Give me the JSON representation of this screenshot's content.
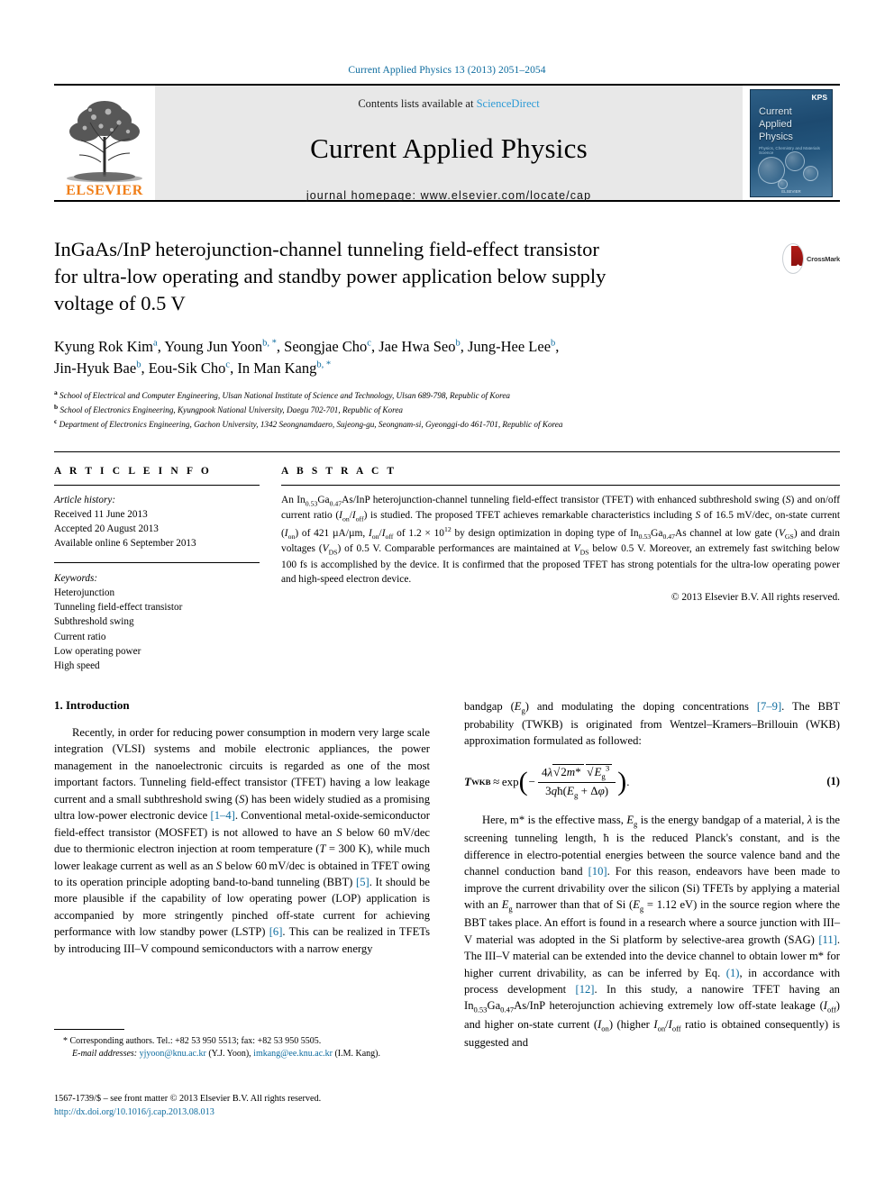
{
  "running_head": "Current Applied Physics 13 (2013) 2051–2054",
  "masthead": {
    "contents_prefix": "Contents lists available at ",
    "contents_link": "ScienceDirect",
    "journal_title": "Current Applied Physics",
    "homepage": "journal homepage: www.elsevier.com/locate/cap",
    "publisher_wordmark": "ELSEVIER",
    "cover": {
      "society": "KPS",
      "title_line1": "Current",
      "title_line2": "Applied",
      "title_line3": "Physics",
      "subtitle": "Physics, Chemistry and Materials Science",
      "footer": "ELSEVIER"
    }
  },
  "title": {
    "line1": "InGaAs/InP heterojunction-channel tunneling field-effect transistor",
    "line2": "for ultra-low operating and standby power application below supply",
    "line3": "voltage of 0.5 V",
    "crossmark_label": "CrossMark"
  },
  "authors": {
    "line1": "Kyung Rok Kim a, Young Jun Yoon b, *, Seongjae Cho c, Jae Hwa Seo b, Jung-Hee Lee b,",
    "line2": "Jin-Hyuk Bae b, Eou-Sik Cho c, In Man Kang b, *",
    "list": [
      {
        "name": "Kyung Rok Kim",
        "marks": "a"
      },
      {
        "name": "Young Jun Yoon",
        "marks": "b, *"
      },
      {
        "name": "Seongjae Cho",
        "marks": "c"
      },
      {
        "name": "Jae Hwa Seo",
        "marks": "b"
      },
      {
        "name": "Jung-Hee Lee",
        "marks": "b"
      },
      {
        "name": "Jin-Hyuk Bae",
        "marks": "b"
      },
      {
        "name": "Eou-Sik Cho",
        "marks": "c"
      },
      {
        "name": "In Man Kang",
        "marks": "b, *"
      }
    ],
    "affiliations": [
      {
        "mark": "a",
        "text": "School of Electrical and Computer Engineering, Ulsan National Institute of Science and Technology, Ulsan 689-798, Republic of Korea"
      },
      {
        "mark": "b",
        "text": "School of Electronics Engineering, Kyungpook National University, Daegu 702-701, Republic of Korea"
      },
      {
        "mark": "c",
        "text": "Department of Electronics Engineering, Gachon University, 1342 Seongnamdaero, Sujeong-gu, Seongnam-si, Gyeonggi-do 461-701, Republic of Korea"
      }
    ]
  },
  "article_info": {
    "label": "A R T I C L E  I N F O",
    "history_label": "Article history:",
    "history": [
      "Received 11 June 2013",
      "Accepted 20 August 2013",
      "Available online 6 September 2013"
    ],
    "keywords_label": "Keywords:",
    "keywords": [
      "Heterojunction",
      "Tunneling field-effect transistor",
      "Subthreshold swing",
      "Current ratio",
      "Low operating power",
      "High speed"
    ]
  },
  "abstract": {
    "label": "A B S T R A C T",
    "copyright": "© 2013 Elsevier B.V. All rights reserved."
  },
  "body": {
    "section1_heading": "1. Introduction",
    "equation_number": "(1)",
    "equation_plain": "T_WKB ≈ exp( - 4λ√(2m*)√(E_g^3) / (3qħ(E_g + Δφ)) )."
  },
  "footnotes": {
    "corresponding": "* Corresponding authors. Tel.: +82 53 950 5513; fax: +82 53 950 5505.",
    "email_label": "E-mail addresses:",
    "email1": "yjyoon@knu.ac.kr",
    "email1_owner": "(Y.J. Yoon)",
    "email2": "imkang@ee.knu.ac.kr",
    "email2_owner": "(I.M. Kang)."
  },
  "imprint": {
    "line": "1567-1739/$ – see front matter © 2013 Elsevier B.V. All rights reserved.",
    "doi": "http://dx.doi.org/10.1016/j.cap.2013.08.013"
  },
  "colors": {
    "link": "#0c6b9e",
    "sciencedirect": "#2e9bd6",
    "elsevier_orange": "#f07f1a"
  }
}
